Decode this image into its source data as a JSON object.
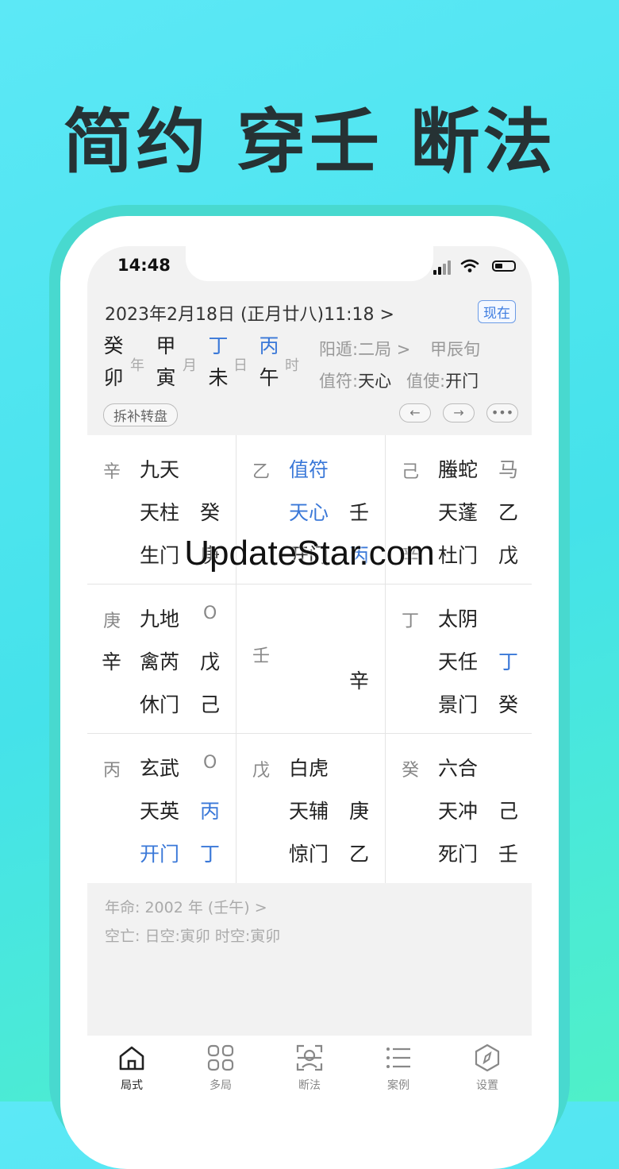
{
  "headline": "简约 穿壬 断法",
  "status": {
    "time": "14:48"
  },
  "header": {
    "date": "2023年2月18日 (正月廿八)11:18 >",
    "now_button": "现在",
    "pillars": [
      {
        "top": "癸",
        "bottom": "卯",
        "suffix": "年",
        "top_blue": false
      },
      {
        "top": "甲",
        "bottom": "寅",
        "suffix": "月",
        "top_blue": false
      },
      {
        "top": "丁",
        "bottom": "未",
        "suffix": "日",
        "top_blue": true
      },
      {
        "top": "丙",
        "bottom": "午",
        "suffix": "时",
        "top_blue": true
      }
    ],
    "dun_label": "阳遁:二局 >",
    "xun": "甲辰旬",
    "zhifu_label": "值符:",
    "zhifu_value": "天心",
    "zhishi_label": "值使:",
    "zhishi_value": "开门",
    "split_button": "拆补转盘",
    "prev_icon": "←",
    "next_icon": "→",
    "more_icon": "•••"
  },
  "palaces": [
    {
      "stem": "辛",
      "deity": "九天",
      "star": "天柱",
      "star_r": "癸",
      "door": "生门",
      "door_r": "庚"
    },
    {
      "stem": "乙",
      "deity": "值符",
      "star": "天心",
      "star_r": "壬",
      "door": "开门",
      "door_r": "丙"
    },
    {
      "stem": "己",
      "deity": "螣蛇",
      "deity_r": "马",
      "star": "天蓬",
      "star_r": "乙",
      "door": "杜门",
      "door_r": "戊",
      "door_l": "辛"
    },
    {
      "stem": "庚",
      "stem2": "辛",
      "deity": "九地",
      "deity_r": "O",
      "star": "禽芮",
      "star_r": "戊",
      "door": "休门",
      "door_r": "己"
    },
    {
      "stem": "壬",
      "center_r": "辛"
    },
    {
      "stem": "丁",
      "deity": "太阴",
      "star": "天任",
      "star_r": "丁",
      "door": "景门",
      "door_r": "癸"
    },
    {
      "stem": "丙",
      "deity": "玄武",
      "deity_r": "O",
      "star": "天英",
      "star_r": "丙",
      "door": "开门",
      "door_r": "丁"
    },
    {
      "stem": "戊",
      "deity": "白虎",
      "star": "天辅",
      "star_r": "庚",
      "door": "惊门",
      "door_r": "乙"
    },
    {
      "stem": "癸",
      "deity": "六合",
      "star": "天冲",
      "star_r": "己",
      "door": "死门",
      "door_r": "壬"
    }
  ],
  "footer": {
    "life": "年命:  2002 年 (壬午) >",
    "void": "空亡:  日空:寅卯 时空:寅卯"
  },
  "tabs": [
    {
      "label": "局式",
      "icon": "home-icon"
    },
    {
      "label": "多局",
      "icon": "grid-icon"
    },
    {
      "label": "断法",
      "icon": "scan-icon"
    },
    {
      "label": "案例",
      "icon": "list-icon"
    },
    {
      "label": "设置",
      "icon": "compass-icon"
    }
  ],
  "watermark": "UpdateStar.com"
}
